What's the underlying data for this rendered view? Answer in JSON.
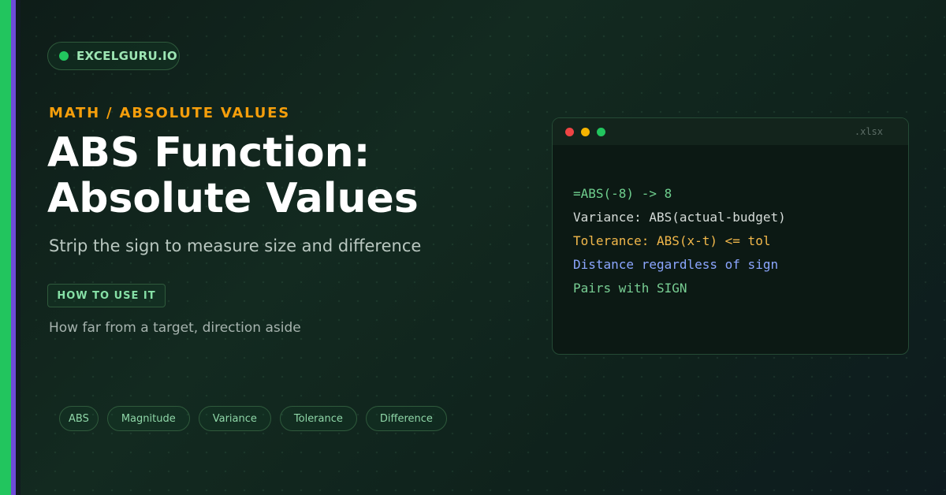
{
  "brand": {
    "name": "EXCELGURU.IO",
    "dot_color": "#22c55e"
  },
  "eyebrow": "MATH / ABSOLUTE VALUES",
  "title": {
    "line1": "ABS Function:",
    "line2": "Absolute Values"
  },
  "subtitle": "Strip the sign to measure size and difference",
  "cta": {
    "label": "HOW TO USE IT"
  },
  "description": "How far from a target, direction aside",
  "code_window": {
    "extension": ".xlsx",
    "lines": [
      {
        "text": "=ABS(-8) -> 8",
        "color": "#6fcf8e"
      },
      {
        "text": "Variance: ABS(actual-budget)",
        "color": "#d6dcd9"
      },
      {
        "text": "Tolerance: ABS(x-t) <= tol",
        "color": "#f2b84b"
      },
      {
        "text": "Distance regardless of sign",
        "color": "#8ca6ff"
      },
      {
        "text": "Pairs with SIGN",
        "color": "#79cf94"
      }
    ]
  },
  "tags": [
    "ABS",
    "Magnitude",
    "Variance",
    "Tolerance",
    "Difference"
  ],
  "colors": {
    "accent": "#22c55e",
    "eyebrow": "#f59e0b",
    "stripe_secondary": "#6d4bd9"
  }
}
